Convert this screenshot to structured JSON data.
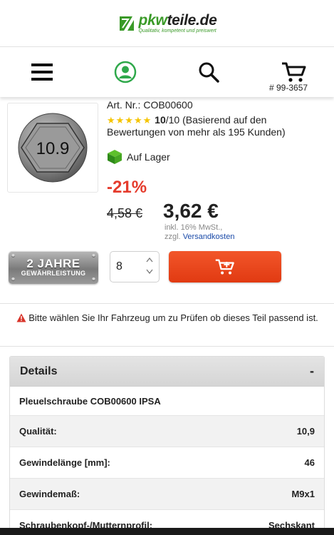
{
  "header": {
    "logo_text_main": "pkw",
    "logo_text_accent": "teile.de",
    "logo_tagline": "Qualitativ, kompetent und preiswert",
    "cart_count": "# 99-3657"
  },
  "product": {
    "image_text": "10.9",
    "art_nr": "Art. Nr.: COB00600",
    "stars": "★★★★★",
    "rating_score": "10",
    "rating_text": "/10 (Basierend auf den Bewertungen von mehr als 195 Kunden)",
    "stock_label": "Auf Lager",
    "discount": "-21%",
    "old_price": "4,58 €",
    "new_price": "3,62 €",
    "vat_text": "inkl. 16% MwSt.,",
    "shipping_prefix": "zzgl. ",
    "shipping_link": "Versandkosten",
    "warranty_line1": "2 JAHRE",
    "warranty_line2": "GEWÄHRLEISTUNG",
    "quantity": "8"
  },
  "notice": {
    "text": "Bitte wählen Sie Ihr Fahrzeug um zu Prüfen ob dieses Teil passend ist."
  },
  "details": {
    "title": "Details",
    "toggle": "-",
    "product_name": "Pleuelschraube COB00600 IPSA",
    "rows": [
      {
        "label": "Qualität:",
        "value": "10,9"
      },
      {
        "label": "Gewindelänge [mm]:",
        "value": "46"
      },
      {
        "label": "Gewindemaß:",
        "value": "M9x1"
      },
      {
        "label": "Schraubenkopf-/Mutternprofil:",
        "value": "Sechskant"
      }
    ]
  },
  "colors": {
    "brand_green": "#3a9a28",
    "discount_red": "#e53b2c",
    "cart_button": "#e13a12",
    "link_blue": "#1a4aa8",
    "star_yellow": "#f5c400"
  },
  "icons": [
    "logo-mark-icon",
    "menu-icon",
    "user-icon",
    "search-icon",
    "cart-icon",
    "stock-box-icon",
    "warning-icon",
    "chevron-up-icon",
    "chevron-down-icon",
    "add-to-cart-icon"
  ]
}
